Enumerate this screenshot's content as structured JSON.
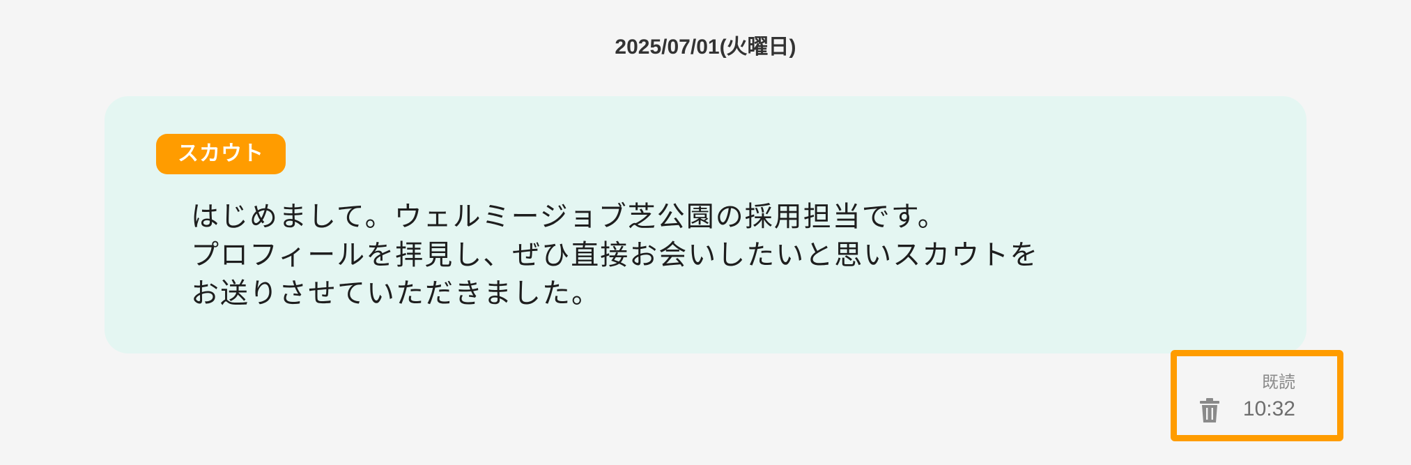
{
  "date_header": "2025/07/01(火曜日)",
  "message": {
    "badge": "スカウト",
    "lines": [
      "はじめまして。ウェルミージョブ芝公園の採用担当です。",
      "プロフィールを拝見し、ぜひ直接お会いしたいと思いスカウトを",
      "お送りさせていただきました。"
    ],
    "read_status": "既読",
    "time": "10:32",
    "delete_icon": "trash-icon"
  },
  "colors": {
    "background": "#f5f5f5",
    "bubble": "#e4f6f2",
    "accent": "#ff9c00"
  }
}
